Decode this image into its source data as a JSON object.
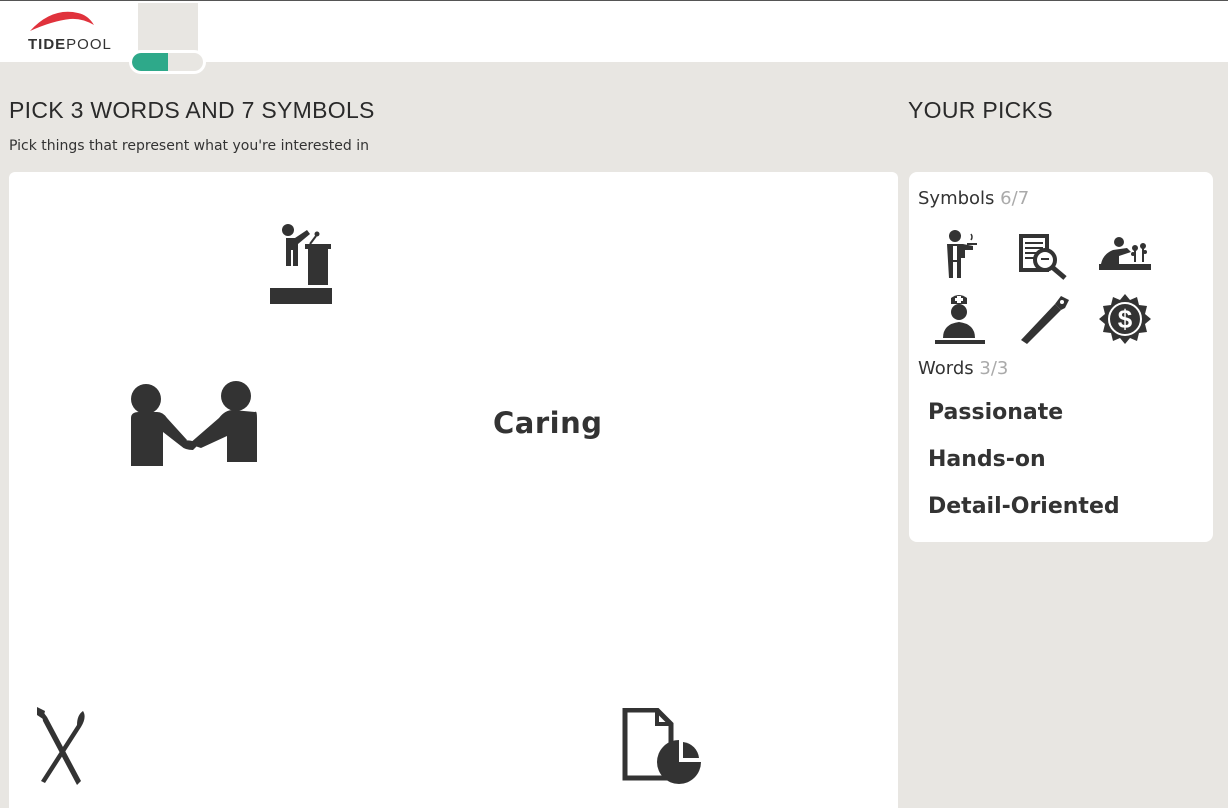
{
  "brand": {
    "name_bold": "TIDE",
    "name_light": "POOL",
    "accent": "#e0323c"
  },
  "progress": {
    "value": 0.5,
    "fill_color": "#2ea98a"
  },
  "main": {
    "title": "PICK 3 WORDS AND 7 SYMBOLS",
    "subtitle": "Pick things that represent what you're interested in",
    "board_words": [
      "Caring"
    ],
    "board_symbols": [
      "speaker-podium-icon",
      "handshake-icon",
      "pen-brush-crossed-icon",
      "document-pie-chart-icon"
    ]
  },
  "picks": {
    "title": "YOUR PICKS",
    "symbols_label": "Symbols",
    "symbols_count": "6/7",
    "symbols": [
      "waiter-icon",
      "document-magnifier-icon",
      "gardener-icon",
      "nurse-icon",
      "saw-icon",
      "dollar-seal-icon"
    ],
    "words_label": "Words",
    "words_count": "3/3",
    "words": [
      "Passionate",
      "Hands-on",
      "Detail-Oriented"
    ]
  }
}
